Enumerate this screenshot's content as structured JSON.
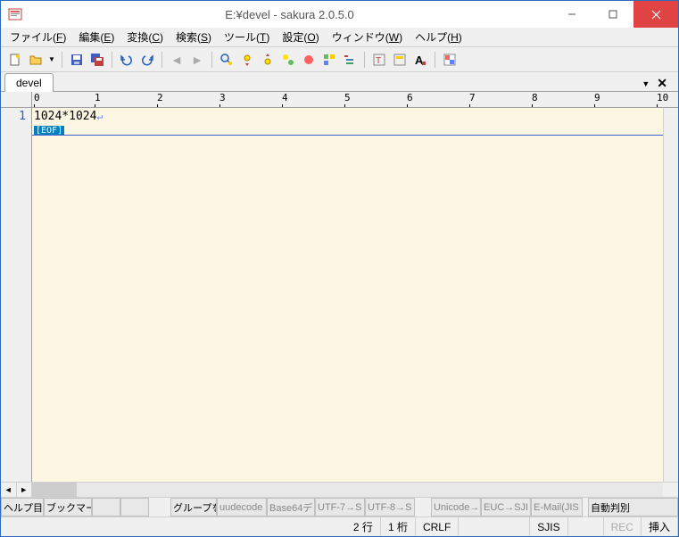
{
  "window": {
    "title": "E:¥devel - sakura 2.0.5.0"
  },
  "menu": {
    "file": "ファイル(F)",
    "edit": "編集(E)",
    "convert": "変換(C)",
    "search": "検索(S)",
    "tool": "ツール(T)",
    "setting": "設定(O)",
    "window": "ウィンドウ(W)",
    "help": "ヘルプ(H)"
  },
  "tab": {
    "active": "devel"
  },
  "ruler": {
    "marks": [
      "0",
      "1",
      "2",
      "3",
      "4",
      "5",
      "6",
      "7",
      "8",
      "9",
      "10"
    ]
  },
  "editor": {
    "line_number": "1",
    "content": "1024*1024",
    "eof": "[EOF]"
  },
  "funcbar": {
    "f1": "ヘルプ目",
    "f2": "ブックマー",
    "f5": "グループを",
    "f6": "uudecode",
    "f7": "Base64デ",
    "f8": "UTF-7→S",
    "f9": "UTF-8→S",
    "f10": "Unicode→",
    "f11": "EUC→SJI",
    "f12": "E-Mail(JIS",
    "f13": "自動判別"
  },
  "status": {
    "line": "2 行",
    "col": "1 桁",
    "eol": "CRLF",
    "enc": "SJIS",
    "rec": "REC",
    "ins": "挿入"
  }
}
